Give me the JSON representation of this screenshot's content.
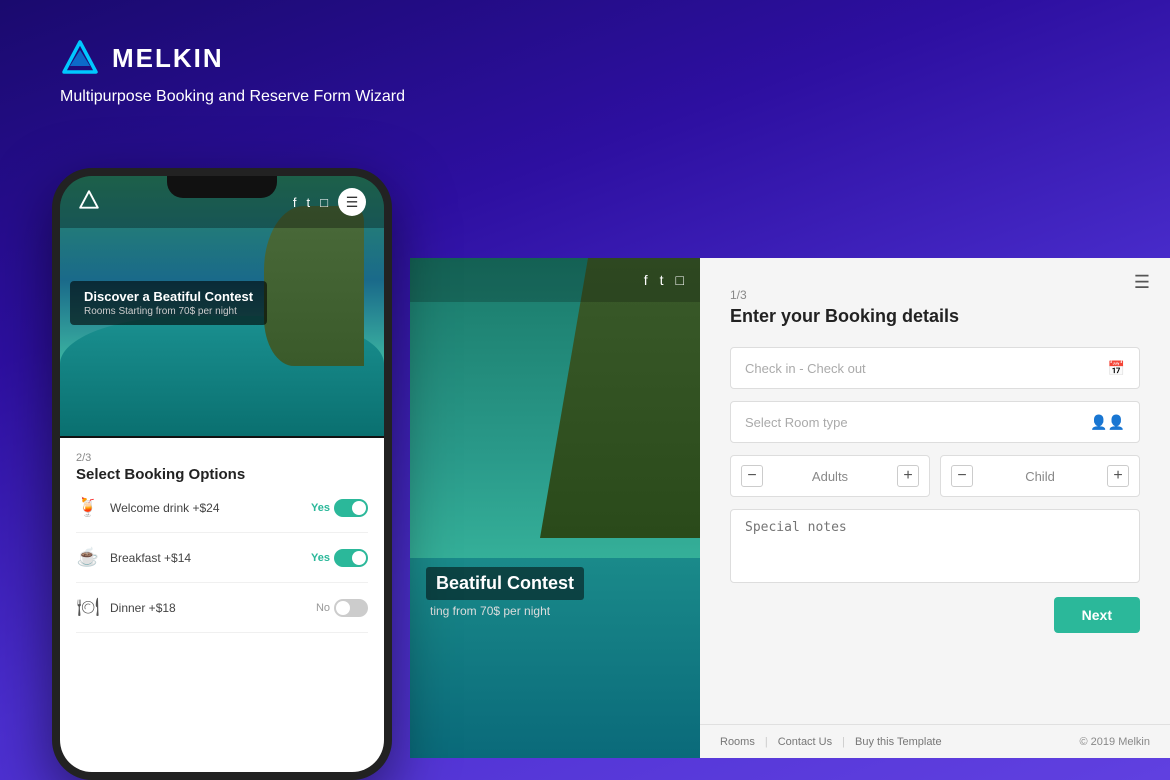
{
  "brand": {
    "name": "MELKIN",
    "tagline": "Multipurpose Booking and Reserve Form Wizard"
  },
  "phone": {
    "hero_title": "Discover a Beatiful Contest",
    "hero_sub": "Rooms Starting from 70$ per night",
    "step": "2/3",
    "step_title": "Select Booking Options",
    "options": [
      {
        "icon": "🍹",
        "label": "Welcome drink +$24",
        "toggled": true,
        "toggle_label": "Yes"
      },
      {
        "icon": "☕",
        "label": "Breakfast +$14",
        "toggled": true,
        "toggle_label": "Yes"
      },
      {
        "icon": "🍽",
        "label": "Dinner +$18",
        "toggled": false,
        "toggle_label": "No"
      }
    ]
  },
  "desktop": {
    "hero_title": "Beatiful Contest",
    "hero_sub": "ting from 70$ per night",
    "nav_icons": [
      "f",
      "t",
      "in"
    ],
    "form": {
      "step": "1/3",
      "title": "Enter your Booking details",
      "checkin_placeholder": "Check in - Check out",
      "room_placeholder": "Select Room type",
      "adults_label": "Adults",
      "child_label": "Child",
      "notes_placeholder": "Special notes",
      "next_btn": "Next"
    }
  },
  "footer": {
    "links": [
      "Rooms",
      "Contact Us",
      "Buy this Template"
    ],
    "copyright": "© 2019 Melkin"
  }
}
